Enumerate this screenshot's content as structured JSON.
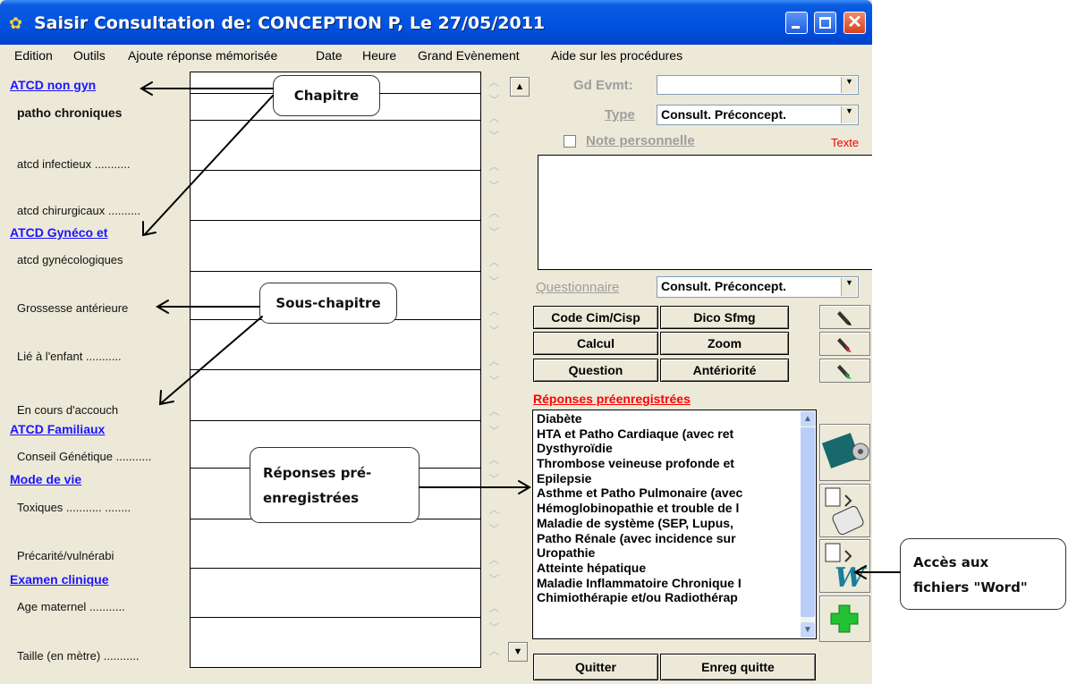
{
  "window": {
    "title": "Saisir Consultation de: CONCEPTION P, Le 27/05/2011"
  },
  "menu": [
    "Edition",
    "Outils",
    "Ajoute réponse mémorisée",
    "Date",
    "Heure",
    "Grand Evènement",
    "Aide sur les procédures"
  ],
  "chapters": [
    "ATCD non gyn",
    "ATCD Gynéco et",
    "ATCD Familiaux",
    "Mode de vie",
    "Examen clinique"
  ],
  "fields": [
    "patho chroniques",
    "atcd infectieux ...........",
    "atcd chirurgicaux ..........",
    "atcd gynécologiques",
    "Grossesse antérieure",
    "Lié à l'enfant ...........",
    "En cours d'accouch",
    "Conseil Génétique ...........",
    "Toxiques ........... ........",
    "Précarité/vulnérabi",
    "Age maternel ...........",
    "Taille (en mètre) ..........."
  ],
  "right": {
    "gd_evmt_label": "Gd Evmt:",
    "gd_evmt_value": "",
    "type_label": "Type",
    "type_value": "Consult. Préconcept.",
    "note_label": "Note personnelle",
    "texte_label": "Texte",
    "questionnaire_label": "Questionnaire",
    "questionnaire_value": "Consult. Préconcept.",
    "buttons": {
      "code": "Code Cim/Cisp",
      "dico": "Dico Sfmg",
      "calcul": "Calcul",
      "zoom": "Zoom",
      "question": "Question",
      "anteriorite": "Antériorité",
      "quitter": "Quitter",
      "enreg": "Enreg quitte"
    },
    "responses_title": "Réponses préenregistrées",
    "responses": [
      "Diabète",
      "HTA et Patho Cardiaque (avec ret",
      "Dysthyroïdie",
      "Thrombose veineuse profonde et",
      "Epilepsie",
      "Asthme et Patho Pulmonaire (avec",
      "Hémoglobinopathie et trouble de l",
      "Maladie de système (SEP, Lupus,",
      "Patho Rénale (avec incidence sur",
      "Uropathie",
      "Atteinte hépatique",
      "Maladie Inflammatoire Chronique I",
      "Chimiothérapie et/ou Radiothérap"
    ]
  },
  "callouts": {
    "chapitre": "Chapitre",
    "sous_chapitre": "Sous-chapitre",
    "reponses_line1": "Réponses pré-",
    "reponses_line2": "enregistrées",
    "word_line1": "Accès aux",
    "word_line2": "fichiers \"Word\""
  },
  "colors": {
    "chapter": "#1d14ff",
    "responses_title": "#ff0000",
    "titlebar": "#0052e0"
  }
}
